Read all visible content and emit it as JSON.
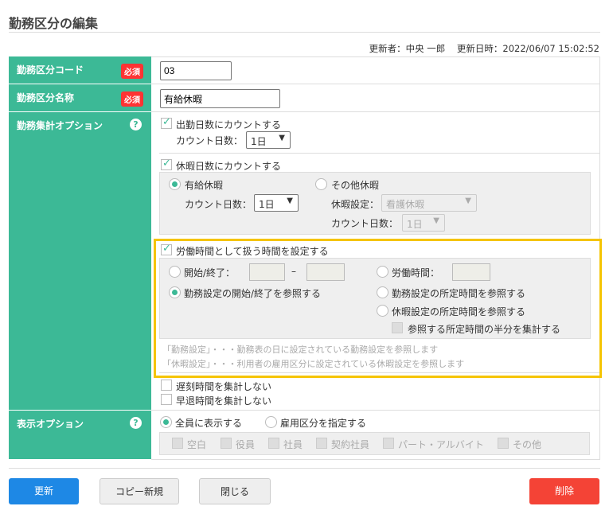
{
  "page": {
    "title": "勤務区分の編集",
    "updater_label": "更新者：",
    "updater": "中央 一郎",
    "updated_label": "更新日時：",
    "updated_at": "2022/06/07 15:02:52"
  },
  "form": {
    "code": {
      "label": "勤務区分コード",
      "required": "必須",
      "value": "03"
    },
    "name": {
      "label": "勤務区分名称",
      "required": "必須",
      "value": "有給休暇"
    },
    "aggregate": {
      "label": "勤務集計オプション",
      "help": "?",
      "count_attendance": "出勤日数にカウントする",
      "count_days_label": "カウント日数：",
      "count_days_value": "1日",
      "count_leave": "休暇日数にカウントする",
      "paid_leave": "有給休暇",
      "paid_count_label": "カウント日数：",
      "paid_count_value": "1日",
      "other_leave": "その他休暇",
      "leave_setting_label": "休暇設定：",
      "leave_setting_value": "看護休暇",
      "other_count_label": "カウント日数：",
      "other_count_value": "1日",
      "work_time_setting": "労働時間として扱う時間を設定する",
      "start_end": "開始/終了：",
      "dash": "–",
      "work_hours": "労働時間：",
      "ref_work_start_end": "勤務設定の開始/終了を参照する",
      "ref_work_scheduled": "勤務設定の所定時間を参照する",
      "ref_leave_scheduled": "休暇設定の所定時間を参照する",
      "half": "参照する所定時間の半分を集計する",
      "note1": "「勤務設定」・・・勤務表の日に設定されている勤務設定を参照します",
      "note2": "「休暇設定」・・・利用者の雇用区分に設定されている休暇設定を参照します",
      "no_late": "遅刻時間を集計しない",
      "no_early": "早退時間を集計しない"
    },
    "display": {
      "label": "表示オプション",
      "help": "?",
      "all": "全員に表示する",
      "specify": "雇用区分を指定する",
      "types": [
        "空白",
        "役員",
        "社員",
        "契約社員",
        "パート・アルバイト",
        "その他"
      ]
    }
  },
  "buttons": {
    "update": "更新",
    "copy": "コピー新規",
    "close": "閉じる",
    "delete": "削除"
  },
  "colors": {
    "green": "#3cb996",
    "highlight": "#f5c400",
    "primary": "#1e88e5",
    "danger": "#f44336"
  }
}
